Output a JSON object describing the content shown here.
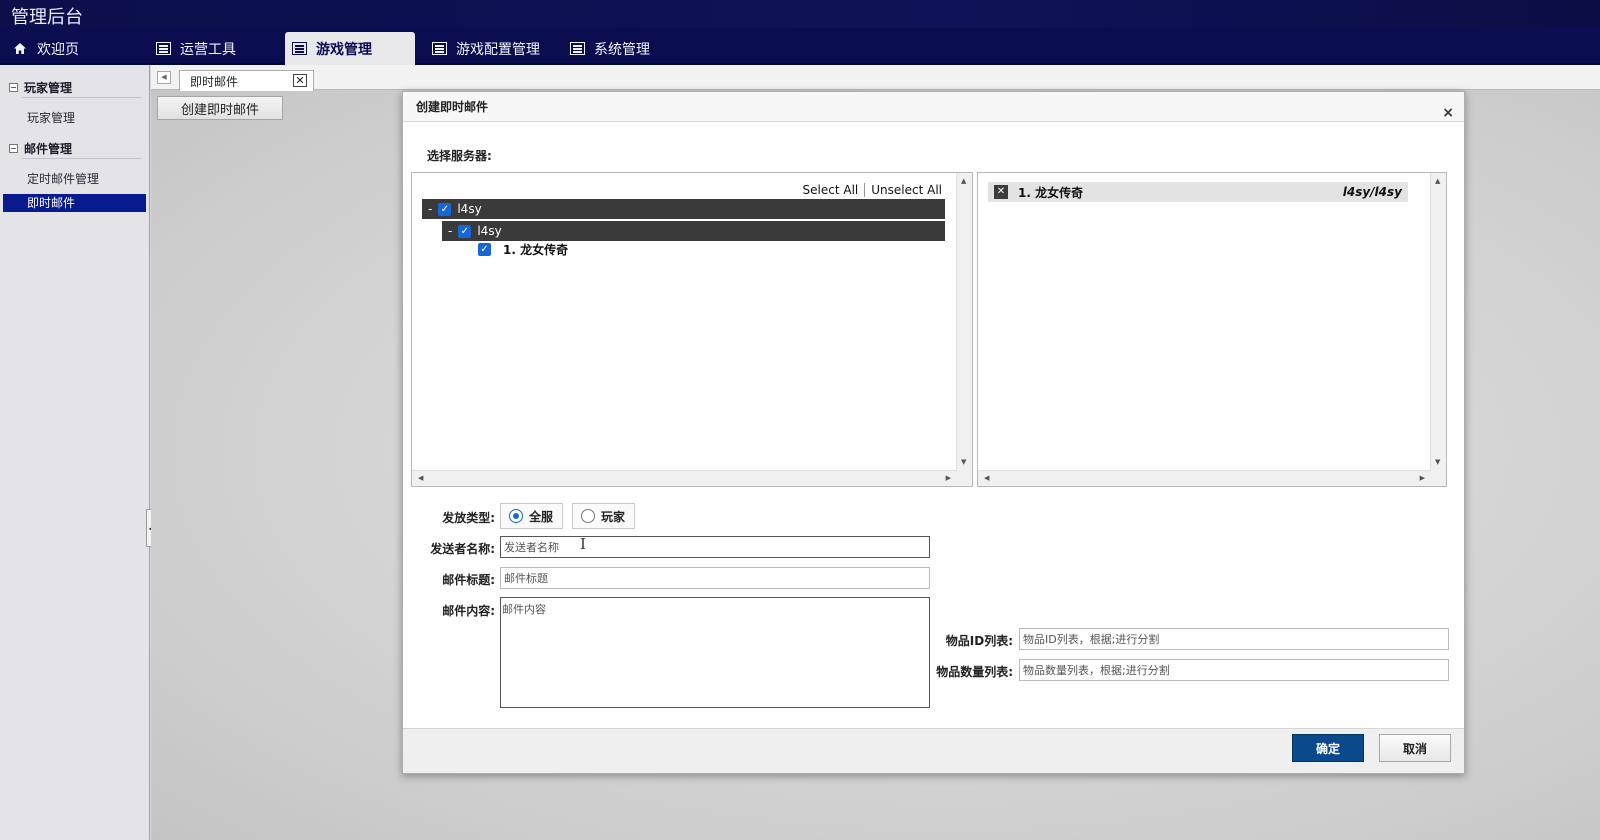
{
  "app": {
    "title": "管理后台"
  },
  "nav": {
    "tabs": [
      {
        "label": "欢迎页",
        "icon": "home-icon"
      },
      {
        "label": "运营工具",
        "icon": "list-icon"
      },
      {
        "label": "游戏管理",
        "icon": "list-icon",
        "active": true
      },
      {
        "label": "游戏配置管理",
        "icon": "list-icon"
      },
      {
        "label": "系统管理",
        "icon": "list-icon"
      }
    ]
  },
  "sidebar": {
    "groups": [
      {
        "title": "玩家管理",
        "toggle": "−",
        "items": [
          {
            "label": "玩家管理"
          }
        ]
      },
      {
        "title": "邮件管理",
        "toggle": "−",
        "items": [
          {
            "label": "定时邮件管理"
          },
          {
            "label": "即时邮件",
            "active": true
          }
        ]
      }
    ]
  },
  "content": {
    "doc_tab": {
      "label": "即时邮件",
      "close": "✕"
    },
    "create_button": "创建即时邮件"
  },
  "modal": {
    "title": "创建即时邮件",
    "close": "×",
    "server_label": "选择服务器:",
    "select_all": "Select All",
    "unselect_all": "Unselect All",
    "tree": [
      {
        "level": 0,
        "label": "l4sy",
        "checked": true
      },
      {
        "level": 1,
        "label": "l4sy",
        "checked": true
      },
      {
        "level": 2,
        "label": "1. 龙女传奇",
        "checked": true
      }
    ],
    "selected": {
      "label": "1. 龙女传奇",
      "path": "l4sy/l4sy"
    },
    "send_type": {
      "label": "发放类型:",
      "options": [
        {
          "label": "全服",
          "checked": true
        },
        {
          "label": "玩家",
          "checked": false
        }
      ]
    },
    "sender": {
      "label": "发送者名称:",
      "placeholder": "发送者名称"
    },
    "subject": {
      "label": "邮件标题:",
      "placeholder": "邮件标题"
    },
    "body": {
      "label": "邮件内容:",
      "placeholder": "邮件内容"
    },
    "item_ids": {
      "label": "物品ID列表:",
      "placeholder": "物品ID列表，根据;进行分割"
    },
    "item_counts": {
      "label": "物品数量列表:",
      "placeholder": "物品数量列表，根据;进行分割"
    },
    "confirm": "确定",
    "cancel": "取消"
  },
  "colors": {
    "nav_bg": "#0a0d4f",
    "sidebar_active": "#0a1a8f",
    "primary_button": "#0a4a8c",
    "checkbox": "#1767d8"
  }
}
